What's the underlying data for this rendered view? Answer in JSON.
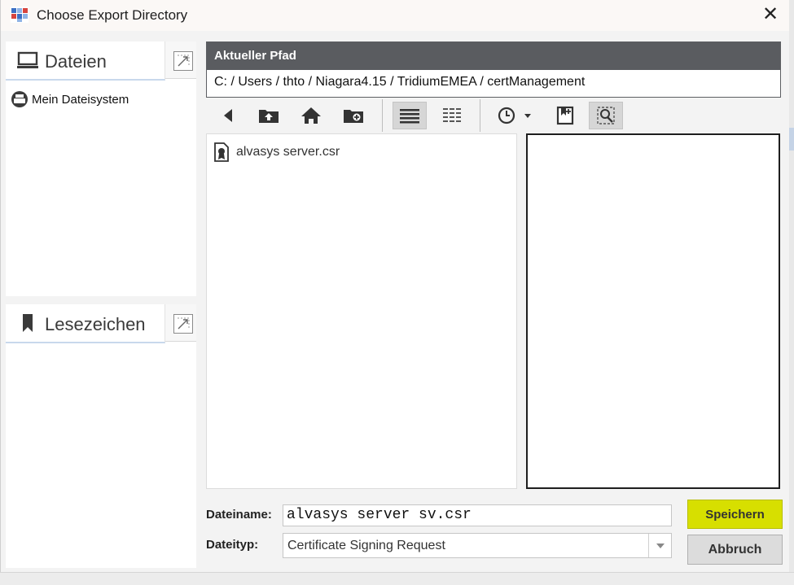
{
  "window": {
    "title": "Choose Export Directory",
    "close_glyph": "✕"
  },
  "left_panels": {
    "files": {
      "label": "Dateien",
      "icon": "monitor-icon",
      "items": [
        {
          "label": "Mein Dateisystem",
          "icon": "drive-icon"
        }
      ]
    },
    "bookmarks": {
      "label": "Lesezeichen",
      "icon": "bookmark-icon"
    }
  },
  "path": {
    "header": "Aktueller Pfad",
    "value": "C: / Users / thto / Niagara4.15 / TridiumEMEA / certManagement"
  },
  "toolbar": {
    "buttons": [
      "back-icon",
      "up-folder-icon",
      "home-icon",
      "new-folder-icon",
      "list-view-icon",
      "details-view-icon",
      "history-icon",
      "bookmark-add-icon",
      "preview-icon"
    ]
  },
  "files": [
    {
      "name": "alvasys server.csr",
      "icon": "certificate-file-icon"
    }
  ],
  "form": {
    "filename_label": "Dateiname:",
    "filename_value": "alvasys server sv.csr",
    "filetype_label": "Dateityp:",
    "filetype_value": "Certificate Signing Request",
    "save_label": "Speichern",
    "cancel_label": "Abbruch"
  },
  "colors": {
    "save_button": "#d7df00",
    "path_header": "#5a5c60"
  }
}
